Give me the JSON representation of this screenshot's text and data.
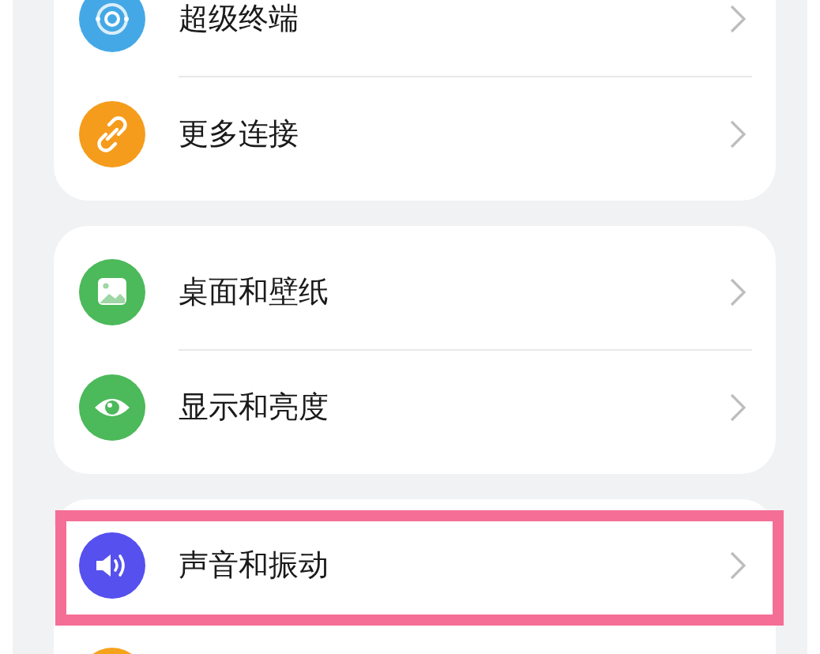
{
  "groups": [
    {
      "items": [
        {
          "kind": "target",
          "color": "#45a8e6",
          "label": "超级终端",
          "highlighted": false
        },
        {
          "kind": "link",
          "color": "#f59c1c",
          "label": "更多连接",
          "highlighted": false
        }
      ]
    },
    {
      "items": [
        {
          "kind": "image",
          "color": "#4cb95a",
          "label": "桌面和壁纸",
          "highlighted": false
        },
        {
          "kind": "eye",
          "color": "#4cb95a",
          "label": "显示和亮度",
          "highlighted": false
        }
      ]
    },
    {
      "items": [
        {
          "kind": "speaker",
          "color": "#5550ee",
          "label": "声音和振动",
          "highlighted": true
        },
        {
          "kind": "blank",
          "color": "#f5a31c",
          "highlighted": false
        }
      ]
    }
  ]
}
